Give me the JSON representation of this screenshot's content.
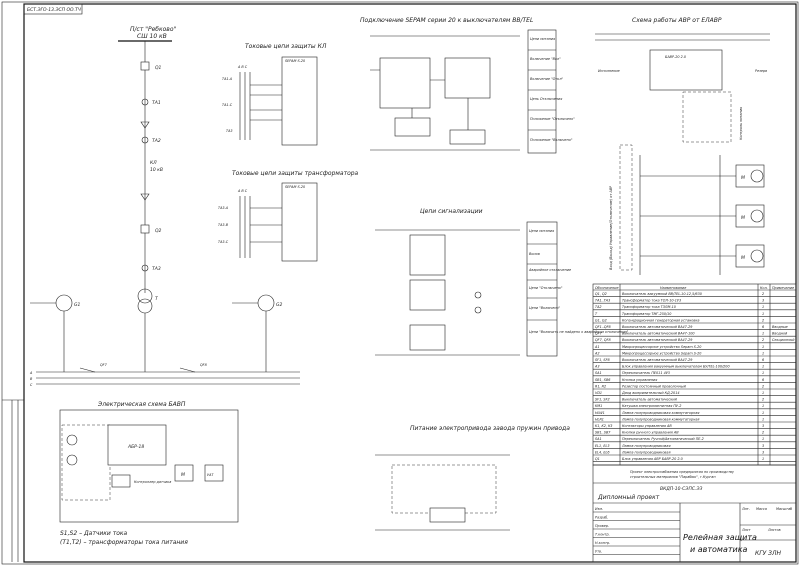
{
  "drawing": {
    "stamp_top": "БСТ.ЭГО-13.ЭСП ОО.ТЧ",
    "source": {
      "title": "П/ст \"Ребково\"",
      "voltage": "СШ 10 кВ"
    },
    "line": {
      "name": "КЛ",
      "voltage": "10 кВ"
    },
    "labels": {
      "q1": "Q1",
      "ta1": "ТА1",
      "ta2": "ТА2",
      "q2": "Q2",
      "ta3": "ТА3",
      "t": "Т",
      "g1": "G1",
      "g2": "G2",
      "qf7": "QF7",
      "qf8": "QF8",
      "bus_a": "A",
      "bus_b": "B",
      "bus_c": "C"
    }
  },
  "sections": {
    "current_circuits_line": "Токовые цепи защиты КЛ",
    "current_circuits_transformer": "Токовые цепи защиты трансформатора",
    "sepam_connection": "Подключение SEPAM серии 20 к выключателям ВВ/TEL",
    "signal_circuits": "Цепи сигнализации",
    "avr_scheme": "Схема работы АВР от ЕЛАВР",
    "bavr_scheme": "Электрическая схема БАВП",
    "drive_power": "Питание электропривода завода пружин привода"
  },
  "ct_labels": {
    "a": "ТА1-А",
    "c": "ТА1-С",
    "n": "ТА3",
    "abc": "A B C",
    "t_a": "ТА3-А",
    "t_b": "ТА3-В",
    "t_c": "ТА3-С",
    "sepam": "SEPAM S-20"
  },
  "side_boxes": {
    "sepam": [
      "Цепи питания",
      "Включение \"Вкл\"",
      "Включение \"Откл\"",
      "Цепь Отключения",
      "Положение \"Отключено\"",
      "Положение \"Включено\""
    ],
    "signal": [
      "Цепи питания",
      "Вызов",
      "Аварийное отключение",
      "Цепи \"Отключено\"",
      "Цепи \"Включено\"",
      "Цепи \"Включить не найдено о аварийном отключении\""
    ]
  },
  "avr": {
    "kl": "Исполнение",
    "reserve": "Резерв",
    "bavr": "БАВР-20 2.0",
    "note": "Вход (Выход) Управление(Отключение) от АВР",
    "note2": "Контроль питания"
  },
  "bavr": {
    "block": "АБР-18",
    "m": "М",
    "yat": "УАТ",
    "legend1": "S1,S2 – Датчики тока",
    "legend2": "(Т1,Т2) – трансформаторы тока питания",
    "controller": "Контроллер датчика"
  },
  "motors": [
    "М",
    "М",
    "М"
  ],
  "spec": {
    "headers": [
      "Обозначение",
      "Наименование",
      "Кол.",
      "Примечание"
    ],
    "rows": [
      [
        "Q1, Q2",
        "Выключатель вакуумный ВВ/TEL-10-12,5/630",
        "2",
        ""
      ],
      [
        "ТА1..ТА3",
        "Трансформатор тока ТОЛ-10-1У3",
        "3",
        ""
      ],
      [
        "ТА2",
        "Трансформатор тока ТЗЛМ-10",
        "1",
        ""
      ],
      [
        "Т",
        "Трансформатор ТМГ-250/10",
        "1",
        ""
      ],
      [
        "G1, G2",
        "Когенерационная генераторная установка",
        "2",
        ""
      ],
      [
        "QF1..QF6",
        "Выключатель автоматический ВА47-29",
        "6",
        "Вводные"
      ],
      [
        "QF7",
        "Выключатель автоматический ВА47-100",
        "1",
        "Вводной"
      ],
      [
        "QF7, QF8",
        "Выключатель автоматический ВА47-29",
        "2",
        "Секционный"
      ],
      [
        "A1",
        "Микропроцессорное устройство Sepam S-20",
        "1",
        ""
      ],
      [
        "A2",
        "Микропроцессорное устройство Sepam S-20",
        "1",
        ""
      ],
      [
        "SF1, SF6",
        "Выключатель автоматический ВА47-29",
        "6",
        ""
      ],
      [
        "A3",
        "Блок управления вакуумным выключателем БУ/TEL-100/200",
        "1",
        ""
      ],
      [
        "SA1",
        "Переключатель ПЕ011 4У3",
        "1",
        ""
      ],
      [
        "SB1, SB6",
        "Кнопка управления",
        "6",
        ""
      ],
      [
        "R1, R2",
        "Резистор постоянный проволочный",
        "2",
        ""
      ],
      [
        "VD1",
        "Диод выпрямительный КД-2014",
        "1",
        ""
      ],
      [
        "SF1, SF2",
        "Выключатель автоматический",
        "2",
        ""
      ],
      [
        "KM1",
        "Катушка электромагнитная ПУ-2",
        "1",
        ""
      ],
      [
        "HLW1",
        "Лампа полупроводниковая коммутаторная",
        "1",
        ""
      ],
      [
        "HLR1",
        "Лампа полупроводниковая коммутаторная",
        "1",
        ""
      ],
      [
        "K1, K2, K3",
        "Контакторы управления АВ",
        "3",
        ""
      ],
      [
        "SB1, SB7",
        "Кнопки ручного управления АВ",
        "2",
        ""
      ],
      [
        "SA1",
        "Переключатель Ручной/Автоматический ПЕ-2",
        "1",
        ""
      ],
      [
        "EL1, EL3",
        "Лампа полупроводниковая",
        "3",
        ""
      ],
      [
        "EL4, EL6",
        "Лампа полупроводниковая",
        "3",
        ""
      ],
      [
        "Q1",
        "Блок управления АВР БАВР-20 2.0",
        "1",
        ""
      ]
    ]
  },
  "title_block": {
    "project": "Проект электроснабжения предприятия по производству строительных материалов \"Парабюк\", г.Курган",
    "code": "ВКДП-10-СЭПС.ЭЗ",
    "type": "Дипломный проект",
    "sheet_title": "Релейная защита и автоматика",
    "org": "КГУ ЗЛН",
    "stage_h": "Лит.",
    "mass_h": "Масса",
    "scale_h": "Масштаб",
    "sheet_h": "Лист",
    "sheets_h": "Листов",
    "roles": [
      "Изм.",
      "Разраб.",
      "Провер.",
      "Т.контр.",
      "Н.контр.",
      "Утв."
    ]
  }
}
